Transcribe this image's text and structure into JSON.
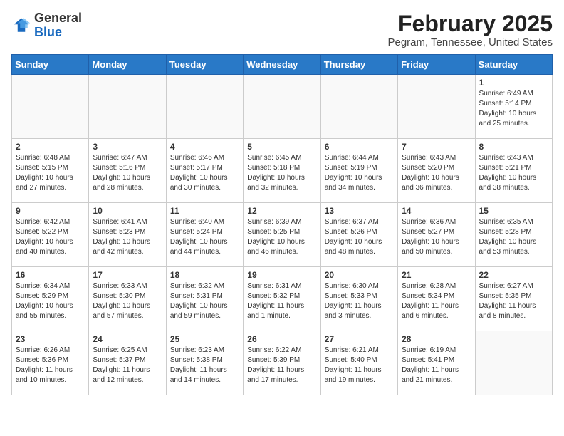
{
  "header": {
    "logo_general": "General",
    "logo_blue": "Blue",
    "month_title": "February 2025",
    "location": "Pegram, Tennessee, United States"
  },
  "weekdays": [
    "Sunday",
    "Monday",
    "Tuesday",
    "Wednesday",
    "Thursday",
    "Friday",
    "Saturday"
  ],
  "weeks": [
    [
      {
        "day": "",
        "info": ""
      },
      {
        "day": "",
        "info": ""
      },
      {
        "day": "",
        "info": ""
      },
      {
        "day": "",
        "info": ""
      },
      {
        "day": "",
        "info": ""
      },
      {
        "day": "",
        "info": ""
      },
      {
        "day": "1",
        "info": "Sunrise: 6:49 AM\nSunset: 5:14 PM\nDaylight: 10 hours and 25 minutes."
      }
    ],
    [
      {
        "day": "2",
        "info": "Sunrise: 6:48 AM\nSunset: 5:15 PM\nDaylight: 10 hours and 27 minutes."
      },
      {
        "day": "3",
        "info": "Sunrise: 6:47 AM\nSunset: 5:16 PM\nDaylight: 10 hours and 28 minutes."
      },
      {
        "day": "4",
        "info": "Sunrise: 6:46 AM\nSunset: 5:17 PM\nDaylight: 10 hours and 30 minutes."
      },
      {
        "day": "5",
        "info": "Sunrise: 6:45 AM\nSunset: 5:18 PM\nDaylight: 10 hours and 32 minutes."
      },
      {
        "day": "6",
        "info": "Sunrise: 6:44 AM\nSunset: 5:19 PM\nDaylight: 10 hours and 34 minutes."
      },
      {
        "day": "7",
        "info": "Sunrise: 6:43 AM\nSunset: 5:20 PM\nDaylight: 10 hours and 36 minutes."
      },
      {
        "day": "8",
        "info": "Sunrise: 6:43 AM\nSunset: 5:21 PM\nDaylight: 10 hours and 38 minutes."
      }
    ],
    [
      {
        "day": "9",
        "info": "Sunrise: 6:42 AM\nSunset: 5:22 PM\nDaylight: 10 hours and 40 minutes."
      },
      {
        "day": "10",
        "info": "Sunrise: 6:41 AM\nSunset: 5:23 PM\nDaylight: 10 hours and 42 minutes."
      },
      {
        "day": "11",
        "info": "Sunrise: 6:40 AM\nSunset: 5:24 PM\nDaylight: 10 hours and 44 minutes."
      },
      {
        "day": "12",
        "info": "Sunrise: 6:39 AM\nSunset: 5:25 PM\nDaylight: 10 hours and 46 minutes."
      },
      {
        "day": "13",
        "info": "Sunrise: 6:37 AM\nSunset: 5:26 PM\nDaylight: 10 hours and 48 minutes."
      },
      {
        "day": "14",
        "info": "Sunrise: 6:36 AM\nSunset: 5:27 PM\nDaylight: 10 hours and 50 minutes."
      },
      {
        "day": "15",
        "info": "Sunrise: 6:35 AM\nSunset: 5:28 PM\nDaylight: 10 hours and 53 minutes."
      }
    ],
    [
      {
        "day": "16",
        "info": "Sunrise: 6:34 AM\nSunset: 5:29 PM\nDaylight: 10 hours and 55 minutes."
      },
      {
        "day": "17",
        "info": "Sunrise: 6:33 AM\nSunset: 5:30 PM\nDaylight: 10 hours and 57 minutes."
      },
      {
        "day": "18",
        "info": "Sunrise: 6:32 AM\nSunset: 5:31 PM\nDaylight: 10 hours and 59 minutes."
      },
      {
        "day": "19",
        "info": "Sunrise: 6:31 AM\nSunset: 5:32 PM\nDaylight: 11 hours and 1 minute."
      },
      {
        "day": "20",
        "info": "Sunrise: 6:30 AM\nSunset: 5:33 PM\nDaylight: 11 hours and 3 minutes."
      },
      {
        "day": "21",
        "info": "Sunrise: 6:28 AM\nSunset: 5:34 PM\nDaylight: 11 hours and 6 minutes."
      },
      {
        "day": "22",
        "info": "Sunrise: 6:27 AM\nSunset: 5:35 PM\nDaylight: 11 hours and 8 minutes."
      }
    ],
    [
      {
        "day": "23",
        "info": "Sunrise: 6:26 AM\nSunset: 5:36 PM\nDaylight: 11 hours and 10 minutes."
      },
      {
        "day": "24",
        "info": "Sunrise: 6:25 AM\nSunset: 5:37 PM\nDaylight: 11 hours and 12 minutes."
      },
      {
        "day": "25",
        "info": "Sunrise: 6:23 AM\nSunset: 5:38 PM\nDaylight: 11 hours and 14 minutes."
      },
      {
        "day": "26",
        "info": "Sunrise: 6:22 AM\nSunset: 5:39 PM\nDaylight: 11 hours and 17 minutes."
      },
      {
        "day": "27",
        "info": "Sunrise: 6:21 AM\nSunset: 5:40 PM\nDaylight: 11 hours and 19 minutes."
      },
      {
        "day": "28",
        "info": "Sunrise: 6:19 AM\nSunset: 5:41 PM\nDaylight: 11 hours and 21 minutes."
      },
      {
        "day": "",
        "info": ""
      }
    ]
  ]
}
